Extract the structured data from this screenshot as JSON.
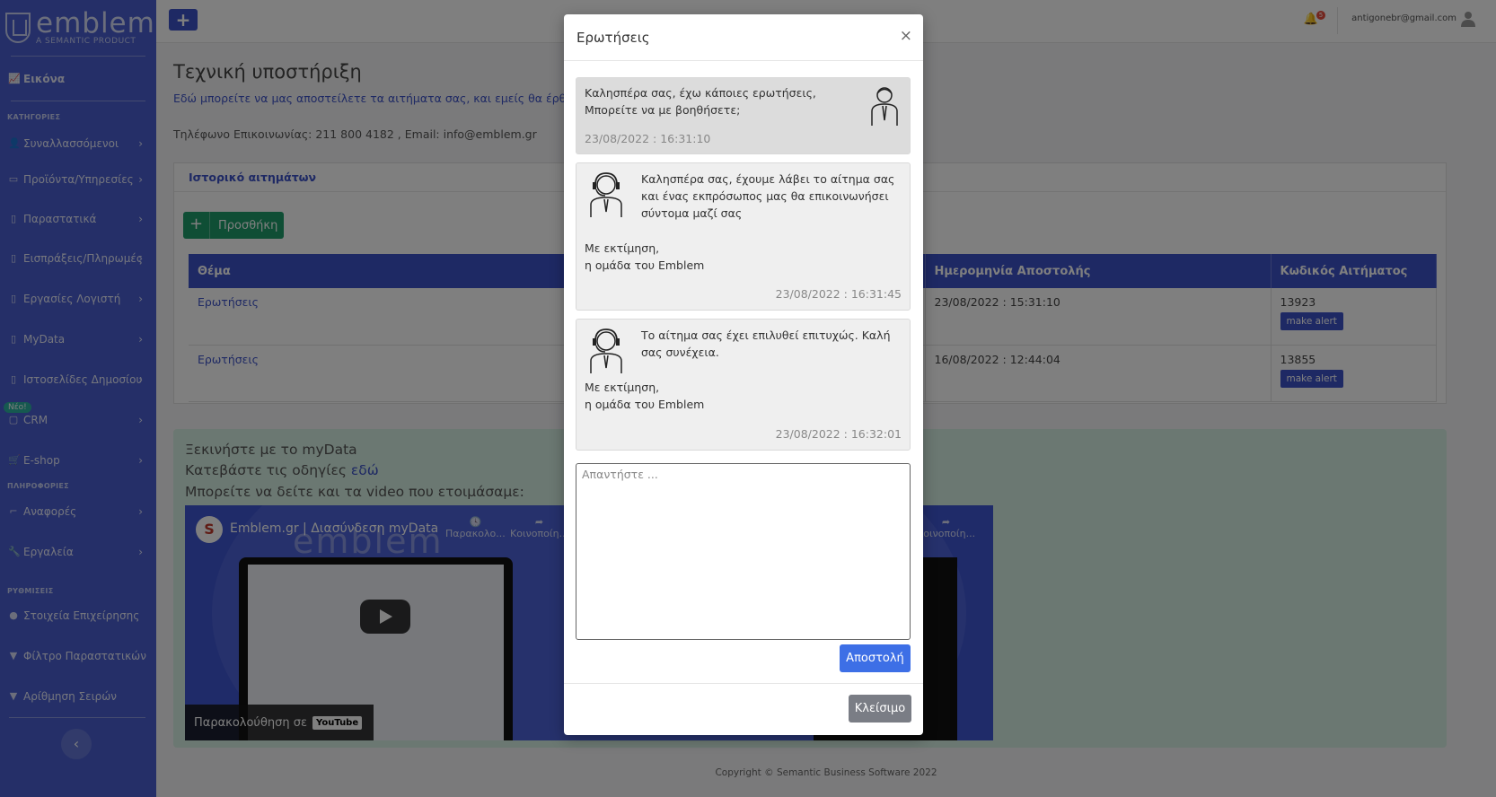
{
  "brand": {
    "name": "emblem",
    "tagline": "A SEMANTIC PRODUCT"
  },
  "sidebar": {
    "top_item": {
      "label": "Εικόνα",
      "icon": "chart-icon"
    },
    "sections": {
      "categories": "ΚΑΤΗΓΟΡΙΕΣ",
      "information": "ΠΛΗΡΟΦΟΡΙΕΣ",
      "settings": "ΡΥΘΜΙΣΕΙΣ"
    },
    "items": [
      {
        "label": "Συναλλασσόμενοι",
        "icon": "user-icon"
      },
      {
        "label": "Προϊόντα/Υπηρεσίες",
        "icon": "box-icon"
      },
      {
        "label": "Παραστατικά",
        "icon": "document-icon"
      },
      {
        "label": "Εισπράξεις/Πληρωμές",
        "icon": "document-icon"
      },
      {
        "label": "Εργασίες Λογιστή",
        "icon": "document-icon"
      },
      {
        "label": "MyData",
        "icon": "document-icon"
      },
      {
        "label": "Ιστοσελίδες Δημοσίου",
        "icon": "document-icon"
      },
      {
        "label": "CRM",
        "icon": "square-icon"
      },
      {
        "label": "E-shop",
        "icon": "cart-icon"
      },
      {
        "label": "Αναφορές",
        "icon": "report-icon"
      },
      {
        "label": "Εργαλεία",
        "icon": "wrench-icon"
      },
      {
        "label": "Στοιχεία Επιχείρησης",
        "icon": "info-icon"
      },
      {
        "label": "Φίλτρο Παραστατικών",
        "icon": "filter-icon"
      },
      {
        "label": "Αρίθμηση Σειρών",
        "icon": "filter-icon"
      }
    ],
    "new_badge": "Νέο!"
  },
  "topbar": {
    "add_label": "+",
    "notifications_count": "5",
    "user_email": "antigonebr@gmail.com"
  },
  "page": {
    "title": "Τεχνική υποστήριξη",
    "description": "Εδώ μπορείτε να μας αποστείλετε τα αιτήματα σας, και εμείς θα έρθουμε σε",
    "contact": "Τηλέφωνο Επικοινωνίας: 211 800 4182 , Email: info@emblem.gr"
  },
  "history": {
    "title": "Ιστορικό αιτημάτων",
    "add_label": "Προσθήκη",
    "columns": [
      "Θέμα",
      "Ημερομηνία Αποστολής",
      "Κωδικός Αιτήματος"
    ],
    "rows": [
      {
        "subject": "Ερωτήσεις",
        "date": "23/08/2022 : 15:31:10",
        "code": "13923",
        "action": "make alert"
      },
      {
        "subject": "Ερωτήσεις",
        "date": "16/08/2022 : 12:44:04",
        "code": "13855",
        "action": "make alert"
      }
    ]
  },
  "mydata": {
    "line1": "Ξεκινήστε με το myData",
    "line2_prefix": "Κατεβάστε τις οδηγίες ",
    "line2_link": "εδώ",
    "line3": "Μπορείτε να δείτε και τα video που ετοιμάσαμε:",
    "video_title": "Emblem.gr | Διασύνδεση myData",
    "video_channel": "S",
    "watch_later": "Παρακολο...",
    "share": "Κοινοποίη...",
    "share2": "Κοινοποίη...",
    "watch_on": "Παρακολούθηση σε",
    "youtube": "YouTube",
    "watermark": "emblem"
  },
  "footer": "Copyright © Semantic Business Software 2022",
  "modal": {
    "title": "Ερωτήσεις",
    "messages": [
      {
        "from": "user",
        "lines": [
          "Καλησπέρα σας, έχω κάποιες ερωτήσεις,",
          "Μπορείτε να με βοηθήσετε;"
        ],
        "time": "23/08/2022 : 16:31:10"
      },
      {
        "from": "support",
        "text": "Καλησπέρα σας, έχουμε λάβει το αίτημα σας και ένας εκπρόσωπος μας θα επικοινωνήσει σύντομα μαζί σας",
        "sign1": "Με εκτίμηση,",
        "sign2": "η ομάδα του Emblem",
        "time": "23/08/2022 : 16:31:45"
      },
      {
        "from": "support",
        "text": "Το αίτημα σας έχει επιλυθεί επιτυχώς. Καλή σας συνέχεια.",
        "sign1": "Με εκτίμηση,",
        "sign2": "η ομάδα του Emblem",
        "time": "23/08/2022 : 16:32:01"
      }
    ],
    "reply_placeholder": "Απαντήστε ...",
    "send_label": "Αποστολή",
    "close_label": "Κλείσιμο"
  }
}
